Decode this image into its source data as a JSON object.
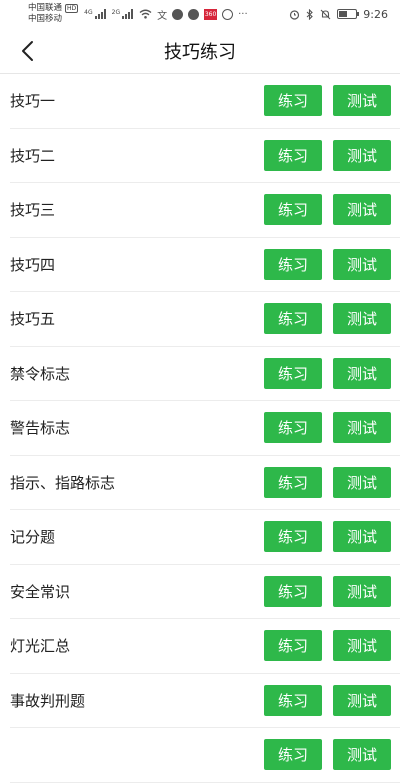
{
  "status_bar": {
    "carrier_1": "中国联通",
    "carrier_1_badge": "HD",
    "carrier_2": "中国移动",
    "net_1": "4G",
    "net_2": "2G",
    "notification_badge": "360",
    "more": "···",
    "time": "9:26",
    "battery_level": 0.5,
    "icons": [
      "signal-icon",
      "wifi-icon",
      "translate-icon",
      "app-icon",
      "message-icon",
      "news-icon",
      "sync-icon",
      "alarm-icon",
      "bluetooth-icon",
      "mute-icon",
      "battery-icon"
    ]
  },
  "header": {
    "title": "技巧练习",
    "back_icon": "chevron-left-icon"
  },
  "items": [
    {
      "label": "技巧一",
      "practice": "练习",
      "test": "测试"
    },
    {
      "label": "技巧二",
      "practice": "练习",
      "test": "测试"
    },
    {
      "label": "技巧三",
      "practice": "练习",
      "test": "测试"
    },
    {
      "label": "技巧四",
      "practice": "练习",
      "test": "测试"
    },
    {
      "label": "技巧五",
      "practice": "练习",
      "test": "测试"
    },
    {
      "label": "禁令标志",
      "practice": "练习",
      "test": "测试"
    },
    {
      "label": "警告标志",
      "practice": "练习",
      "test": "测试"
    },
    {
      "label": "指示、指路标志",
      "practice": "练习",
      "test": "测试"
    },
    {
      "label": "记分题",
      "practice": "练习",
      "test": "测试"
    },
    {
      "label": "安全常识",
      "practice": "练习",
      "test": "测试"
    },
    {
      "label": "灯光汇总",
      "practice": "练习",
      "test": "测试"
    },
    {
      "label": "事故判刑题",
      "practice": "练习",
      "test": "测试"
    },
    {
      "label": "",
      "practice": "练习",
      "test": "测试"
    }
  ],
  "colors": {
    "button_green": "#2eb84a",
    "divider": "#ececec"
  }
}
